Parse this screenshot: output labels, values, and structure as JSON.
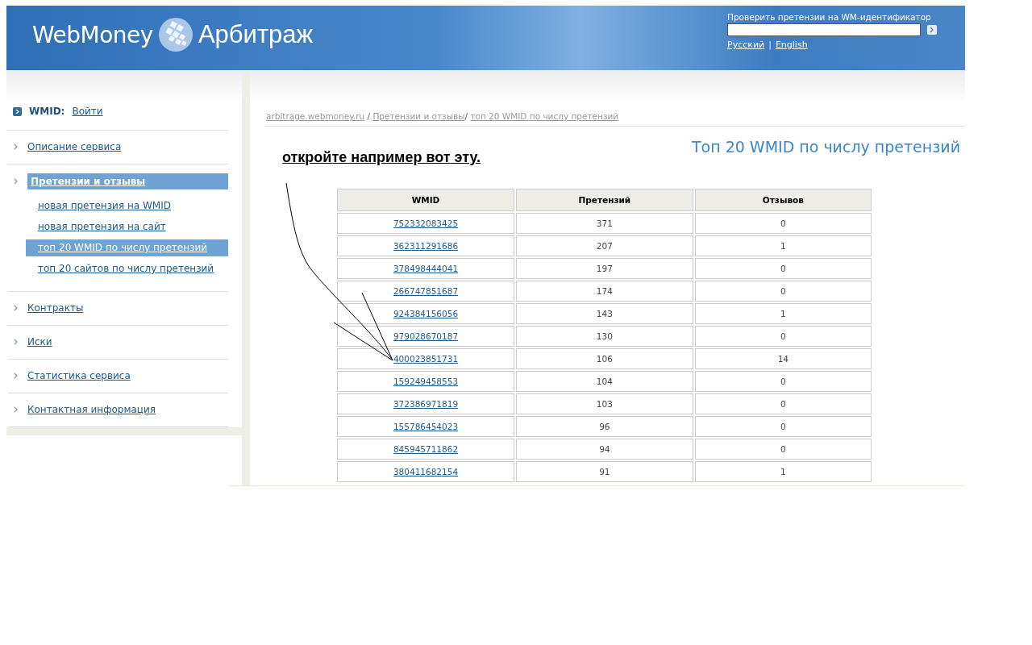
{
  "header": {
    "logo_left": "WebMoney",
    "logo_right": "Арбитраж",
    "check_label": "Проверить претензии на WM-идентификатор",
    "languages": [
      {
        "label": "Русский"
      },
      {
        "label": "English"
      }
    ],
    "language_separator": "|"
  },
  "sidebar": {
    "wmid_label": "WMID:",
    "login": "Войти",
    "items": [
      {
        "label": "Описание сервиса",
        "selected": false
      },
      {
        "label": "Претензии и отзывы",
        "selected": true,
        "children": [
          {
            "label": "новая претензия на WMID",
            "selected": false
          },
          {
            "label": "новая претензия на сайт",
            "selected": false
          },
          {
            "label": "топ 20 WMID по числу претензий",
            "selected": true
          },
          {
            "label": "топ 20 сайтов по числу претензий",
            "selected": false
          }
        ]
      },
      {
        "label": "Контракты",
        "selected": false
      },
      {
        "label": "Иски",
        "selected": false
      },
      {
        "label": "Статистика сервиса",
        "selected": false
      },
      {
        "label": "Контактная информация",
        "selected": false
      }
    ]
  },
  "breadcrumb": [
    {
      "label": "arbitrage.webmoney.ru",
      "separator": " / "
    },
    {
      "label": "Претензии и отзывы",
      "separator": "/ "
    },
    {
      "label": "топ 20 WMID по числу претензий"
    }
  ],
  "annotation": "откройте например вот эту.",
  "page_title": "Топ 20 WMID по числу претензий",
  "table": {
    "columns": [
      "WMID",
      "Претензий",
      "Отзывов"
    ],
    "rows": [
      [
        "752332083425",
        "371",
        "0"
      ],
      [
        "362311291686",
        "207",
        "1"
      ],
      [
        "378498444041",
        "197",
        "0"
      ],
      [
        "266747851687",
        "174",
        "0"
      ],
      [
        "924384156056",
        "143",
        "1"
      ],
      [
        "979028670187",
        "130",
        "0"
      ],
      [
        "400023851731",
        "106",
        "14"
      ],
      [
        "159249458553",
        "104",
        "0"
      ],
      [
        "372386971819",
        "103",
        "0"
      ],
      [
        "155786454023",
        "96",
        "0"
      ],
      [
        "845945711862",
        "94",
        "0"
      ],
      [
        "380411682154",
        "91",
        "1"
      ]
    ]
  }
}
